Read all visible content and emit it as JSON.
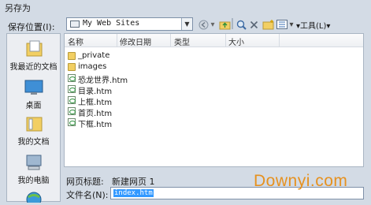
{
  "window": {
    "title": "另存为"
  },
  "savein": {
    "label": "保存位置(I):",
    "path": "My Web Sites"
  },
  "toolbar": {
    "tools_label": "▾工具(L)▾"
  },
  "places": [
    {
      "label": "我最近的文档",
      "icon": "recent-docs-icon"
    },
    {
      "label": "桌面",
      "icon": "desktop-icon"
    },
    {
      "label": "我的文档",
      "icon": "my-documents-icon"
    },
    {
      "label": "我的电脑",
      "icon": "my-computer-icon"
    }
  ],
  "columns": [
    "名称",
    "修改日期",
    "类型",
    "大小"
  ],
  "files": [
    {
      "name": "_private",
      "kind": "folder"
    },
    {
      "name": "images",
      "kind": "folder"
    },
    {
      "name": "恐龙世界.htm",
      "kind": "htm"
    },
    {
      "name": "目录.htm",
      "kind": "htm"
    },
    {
      "name": "上框.htm",
      "kind": "htm"
    },
    {
      "name": "首页.htm",
      "kind": "htm"
    },
    {
      "name": "下框.htm",
      "kind": "htm"
    }
  ],
  "page_title": {
    "label": "网页标题:",
    "value": "新建网页 1"
  },
  "file_name": {
    "label": "文件名(N):",
    "value": "index.htm"
  },
  "watermark": "Downyi.com"
}
